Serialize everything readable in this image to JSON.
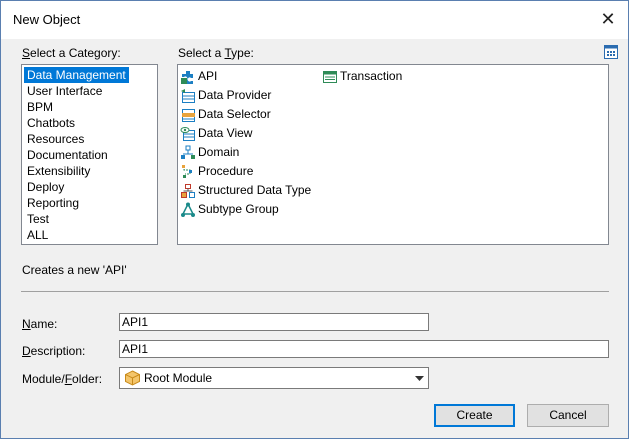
{
  "window": {
    "title": "New Object",
    "close_glyph": "✕"
  },
  "category": {
    "label_pre": "",
    "label_u": "S",
    "label_post": "elect a Category:",
    "items": [
      "Data Management",
      "User Interface",
      "BPM",
      "Chatbots",
      "Resources",
      "Documentation",
      "Extensibility",
      "Deploy",
      "Reporting",
      "Test",
      "ALL"
    ],
    "selected": "Data Management"
  },
  "type": {
    "label_pre": "Select a ",
    "label_u": "T",
    "label_post": "ype:",
    "items": [
      {
        "label": "API",
        "icon": "api-puzzle-icon"
      },
      {
        "label": "Data Provider",
        "icon": "data-provider-icon"
      },
      {
        "label": "Data Selector",
        "icon": "data-selector-icon"
      },
      {
        "label": "Data View",
        "icon": "data-view-icon"
      },
      {
        "label": "Domain",
        "icon": "domain-icon"
      },
      {
        "label": "Procedure",
        "icon": "procedure-icon"
      },
      {
        "label": "Structured Data Type",
        "icon": "structured-data-type-icon"
      },
      {
        "label": "Subtype Group",
        "icon": "subtype-group-icon"
      },
      {
        "label": "Transaction",
        "icon": "transaction-icon"
      }
    ]
  },
  "description_text": "Creates a new 'API'",
  "form": {
    "name_label_u": "N",
    "name_label_post": "ame:",
    "name_value": "API1",
    "desc_label_u": "D",
    "desc_label_post": "escription:",
    "desc_value": "API1",
    "module_label_pre": "Module/",
    "module_label_u": "F",
    "module_label_post": "older:",
    "module_value": "Root Module"
  },
  "buttons": {
    "create": "Create",
    "cancel": "Cancel"
  },
  "colors": {
    "selection": "#0078d7",
    "accent_green": "#2e8b57",
    "accent_orange": "#e8a33c"
  }
}
